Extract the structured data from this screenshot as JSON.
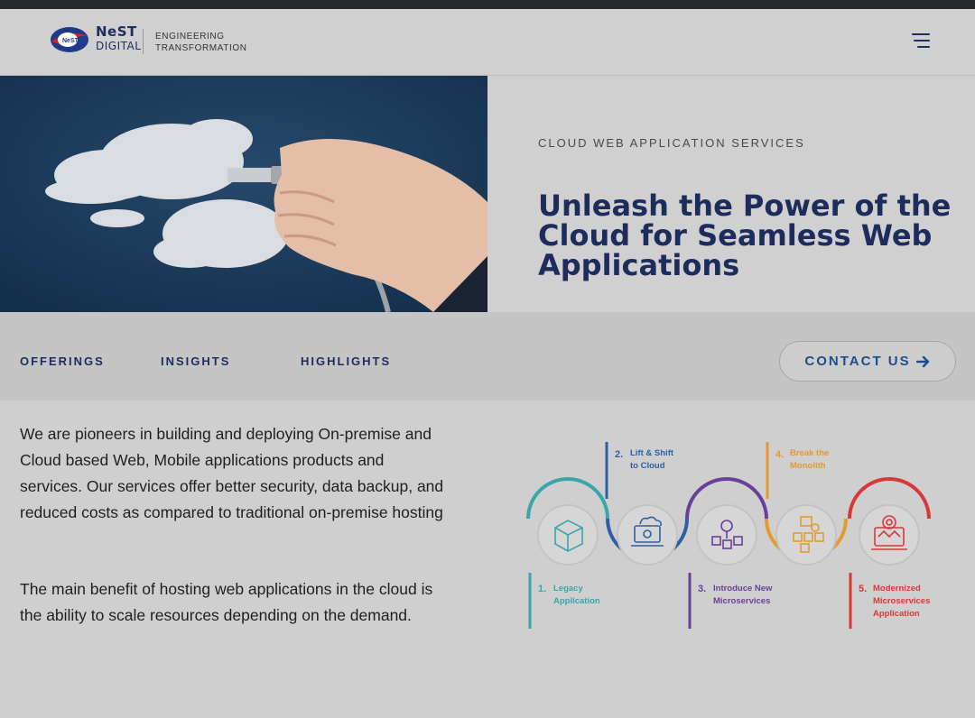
{
  "header": {
    "brand_line1": "NeST",
    "brand_line2": "DIGITAL",
    "tagline_line1": "ENGINEERING",
    "tagline_line2": "TRANSFORMATION",
    "menu_icon": "hamburger-menu-icon"
  },
  "hero": {
    "eyebrow": "CLOUD WEB APPLICATION SERVICES",
    "title": "Unleash the Power of the Cloud for Seamless Web Applications"
  },
  "subnav": {
    "items": [
      "OFFERINGS",
      "INSIGHTS",
      "HIGHLIGHTS"
    ],
    "contact_label": "CONTACT US",
    "contact_icon": "arrow-right-icon"
  },
  "content": {
    "paragraph1": "We are pioneers in building and deploying On-premise and Cloud based Web, Mobile applications products and services. Our services offer better security, data backup, and reduced costs as compared to traditional on-premise hosting",
    "paragraph2": "The main benefit of hosting web applications in the cloud is the ability to scale resources depending on the demand."
  },
  "diagram": {
    "steps": [
      {
        "num": "1.",
        "line1": "Legacy",
        "line2": "Application",
        "line3": "",
        "color": "#3aa6a9",
        "icon": "box-icon"
      },
      {
        "num": "2.",
        "line1": "Lift & Shift",
        "line2": "to Cloud",
        "line3": "",
        "color": "#2e5fa6",
        "icon": "cloud-laptop-icon"
      },
      {
        "num": "3.",
        "line1": "Introduce New",
        "line2": "Microservices",
        "line3": "",
        "color": "#6a3f99",
        "icon": "microservices-icon"
      },
      {
        "num": "4.",
        "line1": "Break the",
        "line2": "Monolith",
        "line3": "",
        "color": "#e39a2f",
        "icon": "monolith-break-icon"
      },
      {
        "num": "5.",
        "line1": "Modernized",
        "line2": "Microservices",
        "line3": "Application",
        "color": "#d8383a",
        "icon": "modern-app-icon"
      }
    ]
  }
}
